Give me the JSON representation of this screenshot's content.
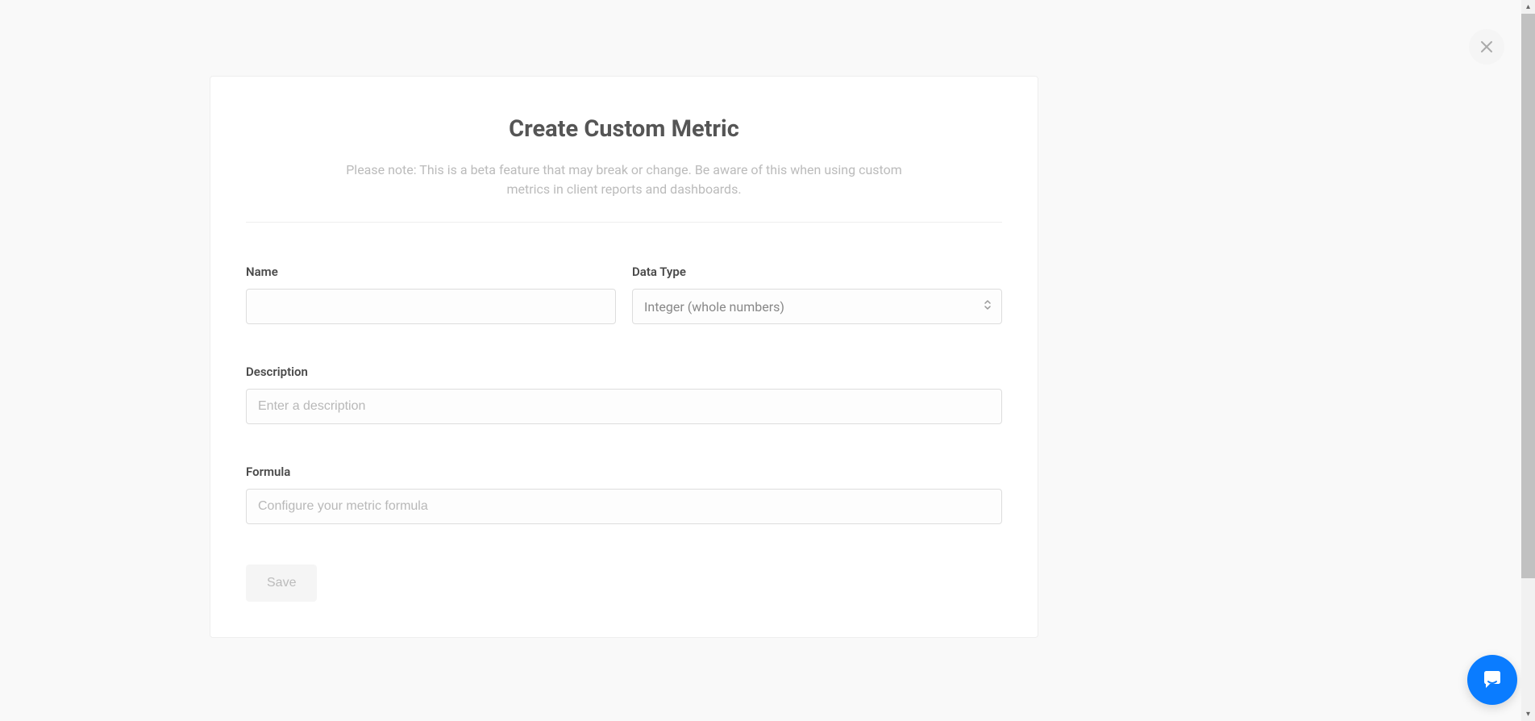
{
  "modal": {
    "title": "Create Custom Metric",
    "subtitle": "Please note: This is a beta feature that may break or change. Be aware of this when using custom metrics in client reports and dashboards."
  },
  "form": {
    "name": {
      "label": "Name",
      "value": ""
    },
    "dataType": {
      "label": "Data Type",
      "selected": "Integer (whole numbers)"
    },
    "description": {
      "label": "Description",
      "placeholder": "Enter a description",
      "value": ""
    },
    "formula": {
      "label": "Formula",
      "placeholder": "Configure your metric formula",
      "value": ""
    }
  },
  "buttons": {
    "save": "Save"
  }
}
